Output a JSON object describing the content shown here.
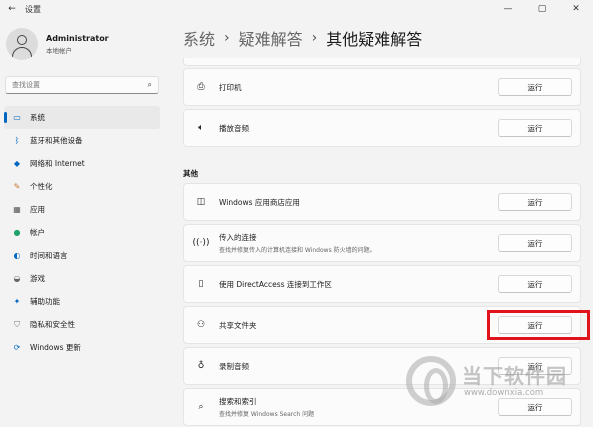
{
  "window": {
    "title": "设置",
    "back_icon": "back-arrow-icon",
    "controls": [
      "—",
      "▢",
      "✕"
    ]
  },
  "profile": {
    "name": "Administrator",
    "account_type": "本地帐户"
  },
  "search": {
    "placeholder": "查找设置"
  },
  "sidebar": {
    "items": [
      {
        "label": "系统",
        "icon": "system-icon",
        "active": true
      },
      {
        "label": "蓝牙和其他设备",
        "icon": "bluetooth-icon"
      },
      {
        "label": "网络和 Internet",
        "icon": "network-icon"
      },
      {
        "label": "个性化",
        "icon": "personalization-icon"
      },
      {
        "label": "应用",
        "icon": "apps-icon"
      },
      {
        "label": "帐户",
        "icon": "accounts-icon"
      },
      {
        "label": "时间和语言",
        "icon": "time-language-icon"
      },
      {
        "label": "游戏",
        "icon": "gaming-icon"
      },
      {
        "label": "辅助功能",
        "icon": "accessibility-icon"
      },
      {
        "label": "隐私和安全性",
        "icon": "privacy-icon"
      },
      {
        "label": "Windows 更新",
        "icon": "windows-update-icon"
      }
    ]
  },
  "breadcrumb": {
    "items": [
      "系统",
      "疑难解答",
      "其他疑难解答"
    ],
    "separator": "›"
  },
  "troubleshooters": {
    "printer": {
      "label": "打印机",
      "button": "运行",
      "icon": "printer-icon"
    },
    "audio": {
      "label": "播放音频",
      "button": "运行",
      "icon": "speaker-icon"
    },
    "section_other": "其他",
    "store_apps": {
      "label": "Windows 应用商店应用",
      "button": "运行",
      "icon": "store-app-icon"
    },
    "incoming": {
      "label": "传入的连接",
      "desc": "查找并修复传入的计算机连接和 Windows 防火墙的问题。",
      "button": "运行",
      "icon": "incoming-connection-icon"
    },
    "directaccess": {
      "label": "使用 DirectAccess 连接到工作区",
      "button": "运行",
      "icon": "phone-icon"
    },
    "shared_folders": {
      "label": "共享文件夹",
      "button": "运行",
      "icon": "shared-folder-icon"
    },
    "record_audio": {
      "label": "录制音频",
      "button": "运行",
      "icon": "microphone-icon"
    },
    "search_index": {
      "label": "搜索和索引",
      "desc": "查找并修复 Windows Search 问题",
      "button": "运行",
      "icon": "search-icon"
    }
  },
  "highlight_color": "#e0121b",
  "accent_color": "#0067c0",
  "watermark": {
    "text": "当下软件园",
    "url": "www.downxia.com"
  }
}
